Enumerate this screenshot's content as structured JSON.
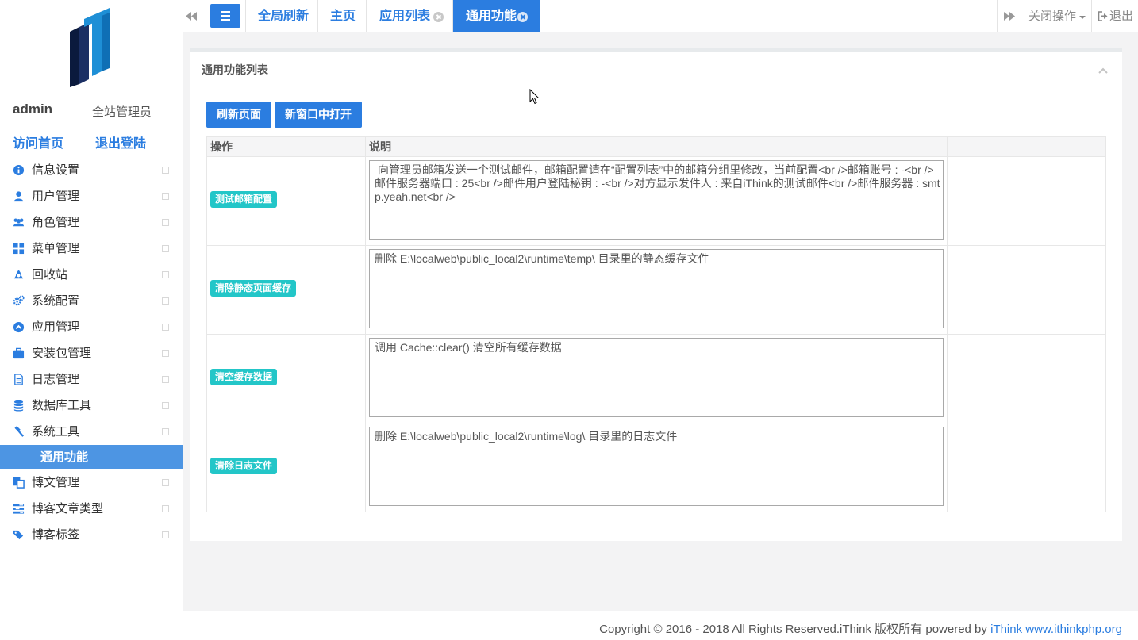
{
  "user": {
    "name": "admin",
    "role": "全站管理员"
  },
  "quick_links": {
    "home": "访问首页",
    "logout": "退出登陆"
  },
  "menu": [
    {
      "label": "信息设置",
      "icon": "info-icon"
    },
    {
      "label": "用户管理",
      "icon": "user-icon"
    },
    {
      "label": "角色管理",
      "icon": "users-icon"
    },
    {
      "label": "菜单管理",
      "icon": "grid-icon"
    },
    {
      "label": "回收站",
      "icon": "recycle-icon"
    },
    {
      "label": "系统配置",
      "icon": "gears-icon"
    },
    {
      "label": "应用管理",
      "icon": "chevron-circle-up-icon"
    },
    {
      "label": "安装包管理",
      "icon": "briefcase-icon"
    },
    {
      "label": "日志管理",
      "icon": "file-text-icon"
    },
    {
      "label": "数据库工具",
      "icon": "database-icon"
    },
    {
      "label": "系统工具",
      "icon": "gavel-icon"
    },
    {
      "label": "博文管理",
      "icon": "files-icon"
    },
    {
      "label": "博客文章类型",
      "icon": "tasks-icon"
    },
    {
      "label": "博客标签",
      "icon": "tags-icon"
    }
  ],
  "menu_sub_active": "通用功能",
  "tabs": {
    "refresh": "全局刷新",
    "home": "主页",
    "applist": "应用列表",
    "common": "通用功能"
  },
  "topbar": {
    "close_ops": "关闭操作",
    "logout": "退出"
  },
  "panel": {
    "title": "通用功能列表",
    "btn_refresh": "刷新页面",
    "btn_newwin": "新窗口中打开",
    "columns": [
      "操作",
      "说明"
    ]
  },
  "rows": [
    {
      "action": "测试邮箱配置",
      "desc": " 向管理员邮箱发送一个测试邮件，邮箱配置请在“配置列表”中的邮箱分组里修改，当前配置<br />邮箱账号 : -<br />邮件服务器端口 : 25<br />邮件用户登陆秘钥 : -<br />对方显示发件人 : 来自iThink的测试邮件<br />邮件服务器 : smtp.yeah.net<br />"
    },
    {
      "action": "清除静态页面缓存",
      "desc": "删除 E:\\localweb\\public_local2\\runtime\\temp\\ 目录里的静态缓存文件"
    },
    {
      "action": "清空缓存数据",
      "desc": "调用 Cache::clear() 清空所有缓存数据"
    },
    {
      "action": "清除日志文件",
      "desc": "删除 E:\\localweb\\public_local2\\runtime\\log\\ 目录里的日志文件"
    }
  ],
  "footer": {
    "text": "Copyright © 2016 - 2018 All Rights Reserved.iThink 版权所有 powered by ",
    "link": "iThink www.ithinkphp.org"
  },
  "colors": {
    "primary": "#2b7de0",
    "teal": "#23c6c8",
    "sub_active": "#4d95e3"
  }
}
